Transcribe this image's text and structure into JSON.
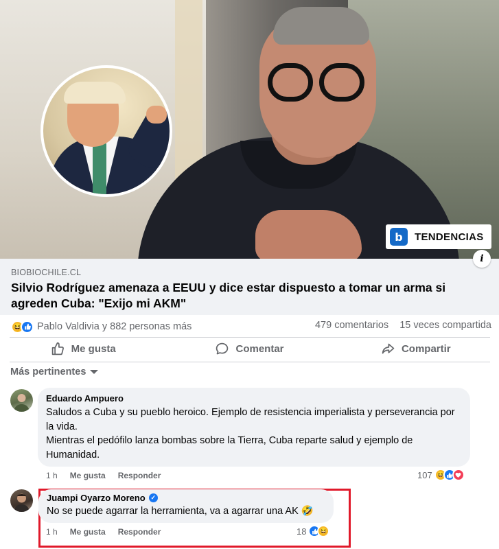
{
  "post": {
    "badge_logo": "b",
    "badge_text": "TENDENCIAS",
    "info_label": "i",
    "domain": "BIOBIOCHILE.CL",
    "headline": "Silvio Rodríguez amenaza a EEUU y dice estar dispuesto a tomar un arma si agreden Cuba: \"Exijo mi AKM\"",
    "reactions": {
      "icons": [
        "haha-emoji-icon",
        "like-icon"
      ],
      "names": "Pablo Valdivia y 882 personas más",
      "comments": "479 comentarios",
      "shares": "15 veces compartida"
    }
  },
  "actions": {
    "like": "Me gusta",
    "comment": "Comentar",
    "share": "Compartir"
  },
  "filter": {
    "label": "Más pertinentes"
  },
  "comments": [
    {
      "author": "Eduardo Ampuero",
      "text_line1": "Saludos a Cuba y su pueblo heroico. Ejemplo de resistencia imperialista y perseverancia por la vida.",
      "text_line2": "Mientras el pedófilo lanza bombas sobre la Tierra, Cuba reparte salud y ejemplo de Humanidad.",
      "time": "1 h",
      "like": "Me gusta",
      "reply": "Responder",
      "reaction_count": "107",
      "reaction_icons": [
        "haha-emoji-icon",
        "like-icon",
        "love-icon"
      ]
    },
    {
      "author": "Juampi Oyarzo Moreno",
      "verified": true,
      "text": "No se puede agarrar la herramienta, va a agarrar una AK 🤣",
      "time": "1 h",
      "like": "Me gusta",
      "reply": "Responder",
      "reaction_count": "18",
      "reaction_icons": [
        "like-icon",
        "haha-emoji-icon"
      ]
    }
  ],
  "colors": {
    "facebook_blue": "#1877f2",
    "highlight_red": "#e0192a",
    "meta_gray": "#65676b",
    "bubble_gray": "#f0f2f5"
  }
}
